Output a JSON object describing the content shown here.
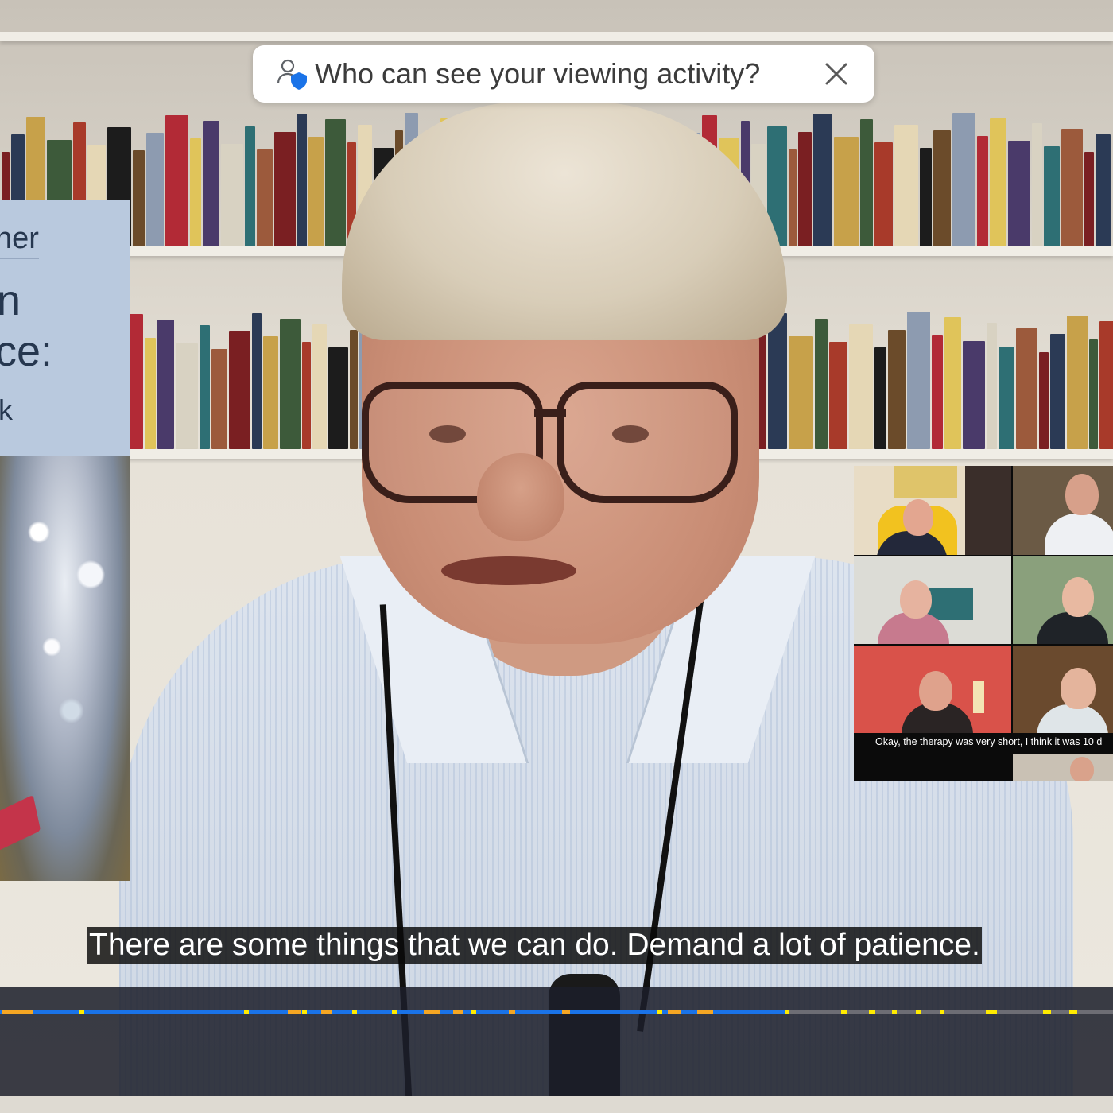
{
  "notice": {
    "text": "Who can see your viewing activity?",
    "icon": "person-shield-icon",
    "close_icon": "close-icon"
  },
  "book_cover": {
    "line1": "ner",
    "line2": "n",
    "line3": "ce:",
    "line4": "k"
  },
  "gallery": {
    "caption": "Okay, the therapy was very short, I think it was 10 d"
  },
  "subtitle": {
    "text": "There are some things that we can do. Demand a lot of patience."
  },
  "player": {
    "progress": 0.705,
    "colors": {
      "played": "#1a73e8",
      "track": "#6d6d74",
      "ad_marker_orange": "#f5a623",
      "ad_marker_yellow": "#ffeb00"
    }
  }
}
